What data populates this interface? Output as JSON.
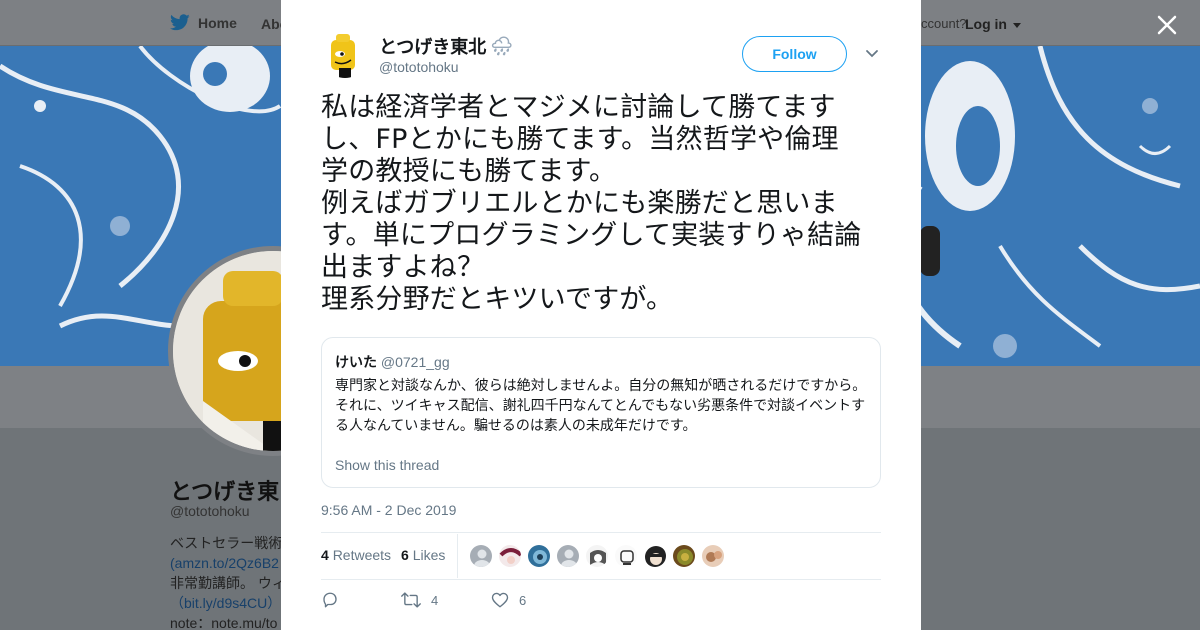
{
  "background": {
    "nav": {
      "home_label": "Home",
      "about_label": "Abo",
      "account_text": "ccount?",
      "login_label": "Log in"
    },
    "profile": {
      "name": "とつげき東",
      "handle": "@tototohoku",
      "bio_lines": [
        "ベストセラー戦術",
        "(amzn.to/2Qz6B2",
        "非常勤講師。 ウィ",
        "（bit.ly/d9s4CU）",
        "note：note.mu/to"
      ]
    }
  },
  "tweet": {
    "author_name": "とつげき東北",
    "author_emoji": "🌧",
    "author_handle": "@tototohoku",
    "follow_label": "Follow",
    "text": "私は経済学者とマジメに討論して勝てます\nし、FPとかにも勝てます。当然哲学や倫理\n学の教授にも勝てます。\n例えばガブリエルとかにも楽勝だと思いま\nす。単にプログラミングして実装すりゃ結論\n出ますよね？\n理系分野だとキツいですが。",
    "quoted": {
      "name": "けいた",
      "handle": "@0721_gg",
      "text": "専門家と対談なんか、彼らは絶対しませんよ。自分の無知が晒されるだけですから。それに、ツイキャス配信、謝礼四千円なんてとんでもない劣悪条件で対談イベントする人なんていません。騙せるのは素人の未成年だけです。",
      "show_thread": "Show this thread"
    },
    "timestamp": "9:56 AM - 2 Dec 2019",
    "retweets_count": "4",
    "retweets_label": "Retweets",
    "likes_count": "6",
    "likes_label": "Likes",
    "action_retweet_count": "4",
    "action_like_count": "6"
  }
}
